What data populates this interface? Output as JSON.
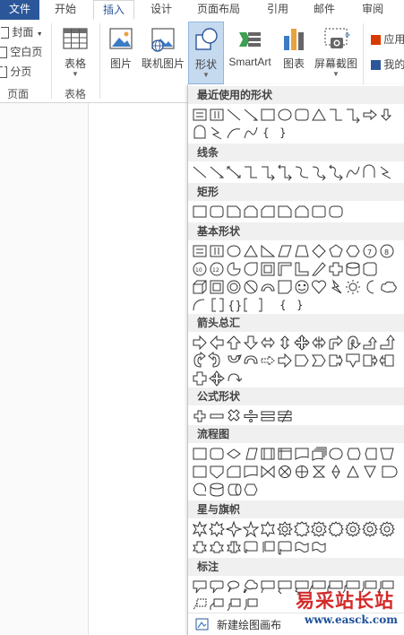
{
  "tabs": {
    "file": "文件",
    "home": "开始",
    "insert": "插入",
    "design": "设计",
    "layout": "页面布局",
    "references": "引用",
    "mailings": "邮件",
    "review": "审阅"
  },
  "ribbon": {
    "pages": {
      "cover": "封面",
      "blank": "空白页",
      "break": "分页",
      "label": "页面"
    },
    "tables": {
      "table": "表格",
      "label": "表格"
    },
    "illustrations": {
      "picture": "图片",
      "online_picture": "联机图片",
      "shapes": "形状",
      "smartart": "SmartArt",
      "chart": "图表",
      "screenshot": "屏幕截图"
    },
    "apps": {
      "store": "应用",
      "my_apps": "我的"
    }
  },
  "shapes_panel": {
    "sections": [
      {
        "title": "最近使用的形状"
      },
      {
        "title": "线条"
      },
      {
        "title": "矩形"
      },
      {
        "title": "基本形状"
      },
      {
        "title": "箭头总汇"
      },
      {
        "title": "公式形状"
      },
      {
        "title": "流程图"
      },
      {
        "title": "星与旗帜"
      },
      {
        "title": "标注"
      }
    ],
    "new_canvas": "新建绘图画布"
  },
  "watermark": {
    "brand": "易采站长站",
    "url": "www.easck.com"
  },
  "colors": {
    "file_tab": "#2b579a",
    "active_tab_text": "#2b579a",
    "section_bg": "#f0f0f0",
    "pressed": "#c5d9ef"
  }
}
